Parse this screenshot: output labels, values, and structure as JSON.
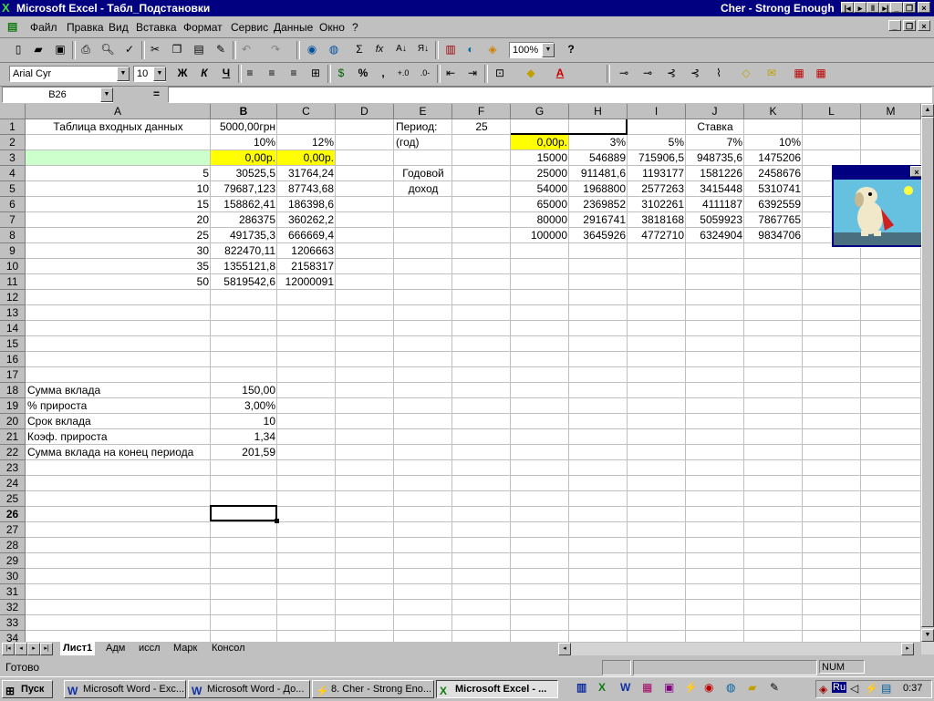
{
  "window": {
    "title": "Microsoft Excel - Табл_Подстановки",
    "song": "Cher - Strong Enough"
  },
  "menu": [
    "Файл",
    "Правка",
    "Вид",
    "Вставка",
    "Формат",
    "Сервис",
    "Данные",
    "Окно",
    "?"
  ],
  "toolbar": {
    "zoom": "100%",
    "font": "Arial Cyr",
    "size": "10",
    "bold": "Ж",
    "italic": "К",
    "underline": "Ч",
    "percent": "%",
    "comma": ",",
    "sigma": "Σ",
    "fx": "fx"
  },
  "formula": {
    "namebox": "B26",
    "eq": "="
  },
  "columns": [
    "A",
    "B",
    "C",
    "D",
    "E",
    "F",
    "G",
    "H",
    "I",
    "J",
    "K",
    "L",
    "M"
  ],
  "rows": [
    "1",
    "2",
    "3",
    "4",
    "5",
    "6",
    "7",
    "8",
    "9",
    "10",
    "11",
    "12",
    "13",
    "14",
    "15",
    "16",
    "17",
    "18",
    "19",
    "20",
    "21",
    "22",
    "23",
    "24",
    "25",
    "26",
    "27",
    "28",
    "29",
    "30",
    "31",
    "32",
    "33",
    "34"
  ],
  "cells": {
    "A1": "Таблица входных данных",
    "B1": "5000,00грн",
    "B2": "10%",
    "C2": "12%",
    "B3": "0,00р.",
    "C3": "0,00р.",
    "A4": "5",
    "B4": "30525,5",
    "C4": "31764,24",
    "A5": "10",
    "B5": "79687,123",
    "C5": "87743,68",
    "A6": "15",
    "B6": "158862,41",
    "C6": "186398,6",
    "A7": "20",
    "B7": "286375",
    "C7": "360262,2",
    "A8": "25",
    "B8": "491735,3",
    "C8": "666669,4",
    "A9": "30",
    "B9": "822470,11",
    "C9": "1206663",
    "A10": "35",
    "B10": "1355121,8",
    "C10": "2158317",
    "A11": "50",
    "B11": "5819542,6",
    "C11": "12000091",
    "E1": "Период:",
    "F1": "25",
    "E2": "(год)",
    "J1": "Ставка",
    "G2": "0,00р.",
    "H2": "3%",
    "I2": "5%",
    "J2": "7%",
    "K2": "10%",
    "G3": "15000",
    "H3": "546889",
    "I3": "715906,5",
    "J3": "948735,6",
    "K3": "1475206",
    "E4": "Годовой",
    "G4": "25000",
    "H4": "911481,6",
    "I4": "1193177",
    "J4": "1581226",
    "K4": "2458676",
    "E5": "доход",
    "G5": "54000",
    "H5": "1968800",
    "I5": "2577263",
    "J5": "3415448",
    "K5": "5310741",
    "G6": "65000",
    "H6": "2369852",
    "I6": "3102261",
    "J6": "4111187",
    "K6": "6392559",
    "G7": "80000",
    "H7": "2916741",
    "I7": "3818168",
    "J7": "5059923",
    "K7": "7867765",
    "G8": "100000",
    "H8": "3645926",
    "I8": "4772710",
    "J8": "6324904",
    "K8": "9834706",
    "A18": "Сумма вклада",
    "B18": "150,00",
    "A19": "% прироста",
    "B19": "3,00%",
    "A20": "Срок вклада",
    "B20": "10",
    "A21": "Коэф. прироста",
    "B21": "1,34",
    "A22": "Сумма вклада на конец периода",
    "B22": "201,59"
  },
  "sheets": [
    "Лист1",
    "Адм",
    "иссл",
    "Марк",
    "Консол"
  ],
  "status": {
    "ready": "Готово",
    "num": "NUM"
  },
  "taskbar": {
    "start": "Пуск",
    "tasks": [
      "Microsoft Word - Exc...",
      "Microsoft Word - До...",
      "8. Cher - Strong Eno...",
      "Microsoft Excel - ..."
    ],
    "lang": "Ru",
    "clock": "0:37"
  }
}
